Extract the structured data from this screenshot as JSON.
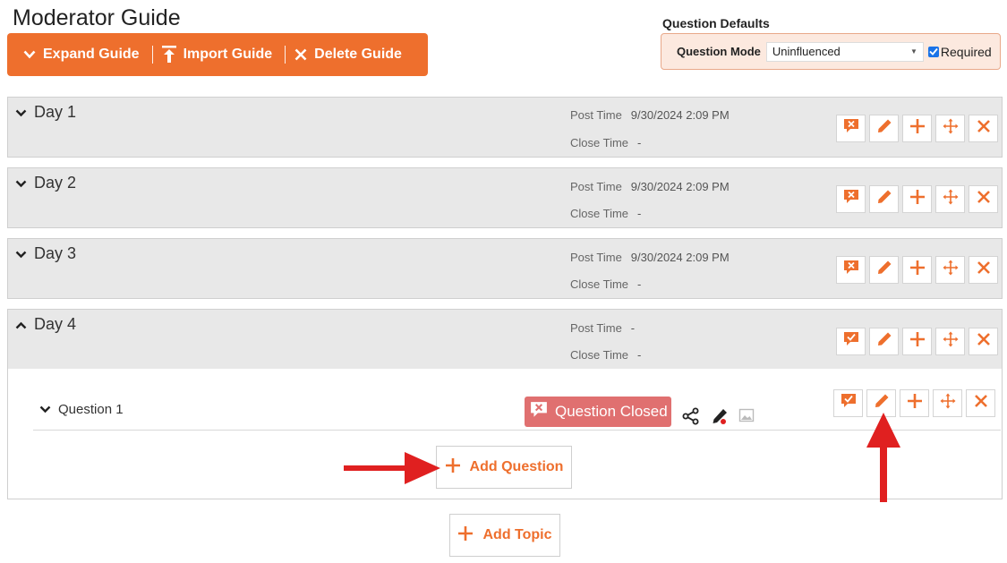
{
  "page": {
    "title": "Moderator Guide"
  },
  "toolbar": {
    "expand_label": "Expand Guide",
    "import_label": "Import Guide",
    "delete_label": "Delete Guide"
  },
  "question_defaults": {
    "title": "Question Defaults",
    "mode_label": "Question Mode",
    "mode_value": "Uninfluenced",
    "required_label": "Required",
    "required_checked": true
  },
  "topics": [
    {
      "name": "Day 1",
      "post_time_label": "Post Time",
      "post_time": "9/30/2024 2:09 PM",
      "close_time_label": "Close Time",
      "close_time": "-",
      "expanded": false
    },
    {
      "name": "Day 2",
      "post_time_label": "Post Time",
      "post_time": "9/30/2024 2:09 PM",
      "close_time_label": "Close Time",
      "close_time": "-",
      "expanded": false
    },
    {
      "name": "Day 3",
      "post_time_label": "Post Time",
      "post_time": "9/30/2024 2:09 PM",
      "close_time_label": "Close Time",
      "close_time": "-",
      "expanded": false
    },
    {
      "name": "Day 4",
      "post_time_label": "Post Time",
      "post_time": "-",
      "close_time_label": "Close Time",
      "close_time": "-",
      "expanded": true
    }
  ],
  "question": {
    "name": "Question 1",
    "status": "Question Closed"
  },
  "buttons": {
    "add_question": "Add Question",
    "add_topic": "Add Topic"
  },
  "colors": {
    "accent": "#ee6f2d",
    "closed_badge": "#e07070",
    "annotation_arrow": "#e02020"
  }
}
